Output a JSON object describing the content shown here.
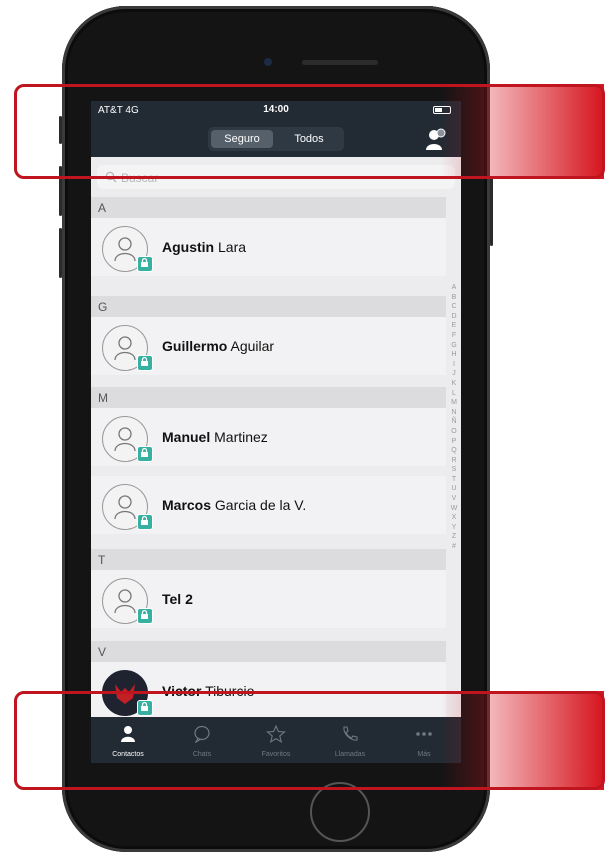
{
  "status_bar": {
    "carrier": "AT&T 4G",
    "time": "14:00"
  },
  "header": {
    "segments": [
      "Seguro",
      "Todos"
    ],
    "active_segment": "Seguro",
    "add_contact_icon": "add-contact-icon"
  },
  "search": {
    "placeholder": "Buscar"
  },
  "sections": [
    {
      "letter": "A",
      "contacts": [
        {
          "first": "Agustin",
          "last": "Lara",
          "secure": true
        }
      ]
    },
    {
      "letter": "G",
      "contacts": [
        {
          "first": "Guillermo",
          "last": "Aguilar",
          "secure": true
        }
      ]
    },
    {
      "letter": "M",
      "contacts": [
        {
          "first": "Manuel",
          "last": "Martinez",
          "secure": true
        },
        {
          "first": "Marcos",
          "last": "Garcia de la V.",
          "secure": true
        }
      ]
    },
    {
      "letter": "T",
      "contacts": [
        {
          "first": "Tel 2",
          "last": "",
          "secure": true
        }
      ]
    },
    {
      "letter": "V",
      "contacts": [
        {
          "first": "Victor",
          "last": "Tiburcio",
          "secure": true
        }
      ]
    }
  ],
  "alphabet_index": [
    "A",
    "B",
    "C",
    "D",
    "E",
    "F",
    "G",
    "H",
    "I",
    "J",
    "K",
    "L",
    "M",
    "N",
    "Ñ",
    "O",
    "P",
    "Q",
    "R",
    "S",
    "T",
    "U",
    "V",
    "W",
    "X",
    "Y",
    "Z",
    "#"
  ],
  "tabbar": [
    {
      "label": "Contactos",
      "icon": "person-icon",
      "active": true
    },
    {
      "label": "Chats",
      "icon": "chat-bubble-icon",
      "active": false
    },
    {
      "label": "Favoritos",
      "icon": "star-icon",
      "active": false
    },
    {
      "label": "Llamadas",
      "icon": "phone-icon",
      "active": false
    },
    {
      "label": "Más",
      "icon": "more-icon",
      "active": false
    }
  ],
  "colors": {
    "header": "#222a33",
    "secure_badge": "#35b0a1",
    "highlight": "#c0141e"
  }
}
